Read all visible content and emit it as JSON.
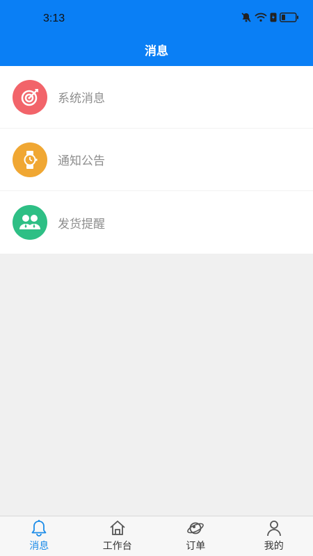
{
  "status_bar": {
    "time": "3:13"
  },
  "header": {
    "title": "消息"
  },
  "messages": [
    {
      "label": "系统消息",
      "icon": "target-icon",
      "color": "#f2646a"
    },
    {
      "label": "通知公告",
      "icon": "watch-icon",
      "color": "#f0a733"
    },
    {
      "label": "发货提醒",
      "icon": "users-icon",
      "color": "#2ebf85"
    }
  ],
  "tabs": [
    {
      "label": "消息",
      "icon": "bell-icon",
      "active": true
    },
    {
      "label": "工作台",
      "icon": "home-icon",
      "active": false
    },
    {
      "label": "订单",
      "icon": "planet-icon",
      "active": false
    },
    {
      "label": "我的",
      "icon": "person-icon",
      "active": false
    }
  ],
  "colors": {
    "header": "#0a7ff5",
    "tab_active": "#1a8be8"
  }
}
